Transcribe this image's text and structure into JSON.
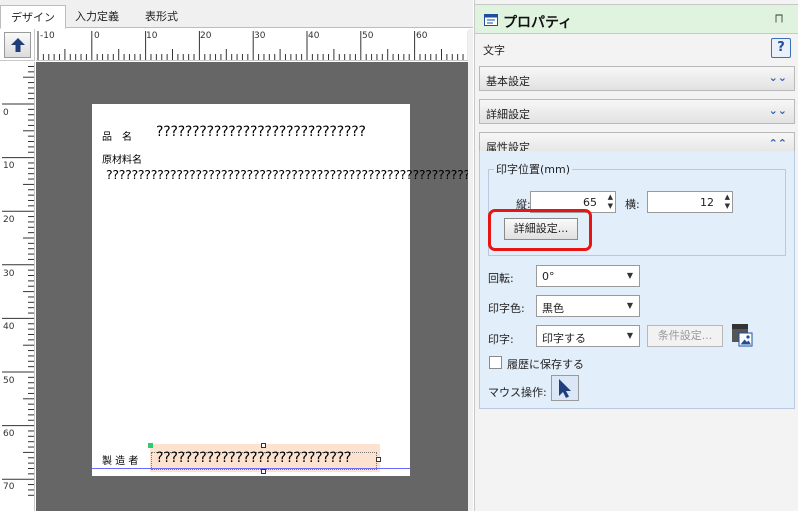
{
  "tabs": [
    {
      "label": "デザイン",
      "active": true
    },
    {
      "label": "入力定義",
      "active": false
    },
    {
      "label": "表形式",
      "active": false
    }
  ],
  "ruler": {
    "h_labels": [
      "-10",
      "0",
      "10",
      "20",
      "30",
      "40",
      "50",
      "60"
    ],
    "v_labels": [
      "0",
      "10",
      "20",
      "30",
      "40",
      "50",
      "60",
      "70"
    ]
  },
  "label": {
    "product_label": "品　名",
    "product_value": "?????????????????????????????",
    "material_label": "原材料名",
    "material_text": "??????????????????????????????????????????????????????????????????????????????????????????????????????????????????????????????????????????????????????????????????????????????????????????????????????????????????????????????????????????????????????????????????????????????????????????????????????????????????????????????????????????????????????????????????????????????????????????????????????????????????????????????????????????????????????????????????????????????????????????????????????????????????????????????????????????????????????????????????????????????????????????????????????????????????????????????????????????????????????????????????????????????????????",
    "maker_label": "製 造 者",
    "maker_value": "???????????????????????????"
  },
  "panel": {
    "title": "プロパティ",
    "object_type": "文字",
    "help": "?",
    "sections": {
      "basic": "基本設定",
      "detail": "詳細設定",
      "attribute": "属性設定"
    },
    "print_position": {
      "legend": "印字位置(mm)",
      "vertical_label": "縦:",
      "vertical_value": "65",
      "horizontal_label": "横:",
      "horizontal_value": "12",
      "detail_button": "詳細設定..."
    },
    "rotation": {
      "label": "回転:",
      "value": "0°"
    },
    "print_color": {
      "label": "印字色:",
      "value": "黒色"
    },
    "print": {
      "label": "印字:",
      "value": "印字する",
      "condition_button": "条件設定..."
    },
    "save_history": {
      "label": "履歴に保存する",
      "checked": false
    },
    "mouse_op": {
      "label": "マウス操作:"
    }
  },
  "colors": {
    "panel_header": "#dff3df",
    "attr_body": "#e3eefb",
    "highlight": "#e81313",
    "selection": "#fde3cf",
    "canvas": "#666666"
  }
}
